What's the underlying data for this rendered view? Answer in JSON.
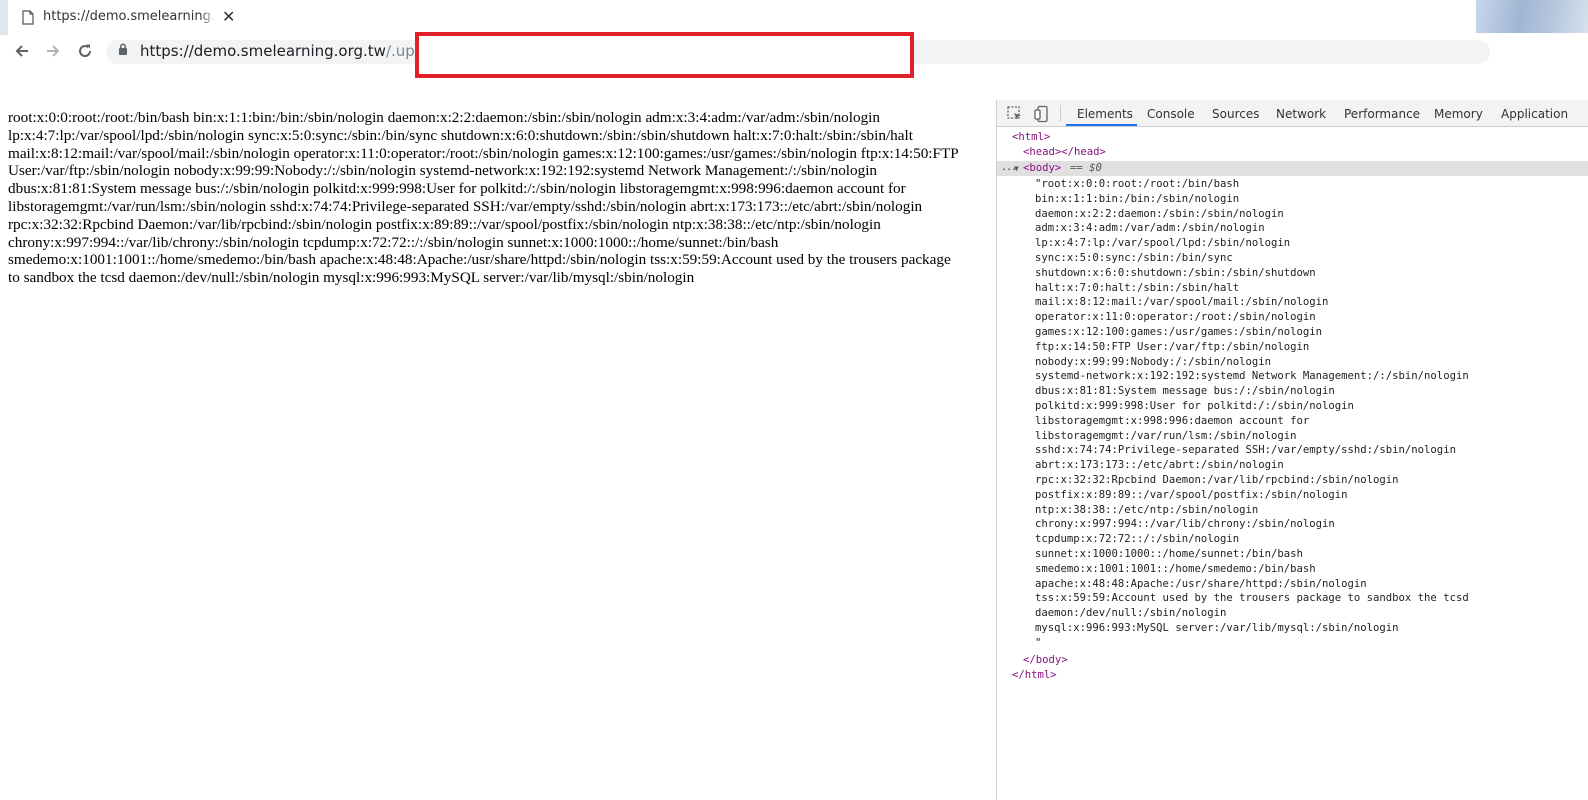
{
  "browser": {
    "tab_title": "https://demo.smelearning.org.tw/.upload/",
    "tab_close": "✕",
    "url_host": "https://demo.smelearning.org.tw",
    "url_path": "/.upload/",
    "icons": {
      "back": "arrow-left-icon",
      "forward": "arrow-right-icon",
      "reload": "reload-icon",
      "lock": "lock-icon",
      "favicon": "page-icon"
    },
    "redaction_color": "#e2202a"
  },
  "page": {
    "content": "root:x:0:0:root:/root:/bin/bash bin:x:1:1:bin:/bin:/sbin/nologin daemon:x:2:2:daemon:/sbin:/sbin/nologin adm:x:3:4:adm:/var/adm:/sbin/nologin lp:x:4:7:lp:/var/spool/lpd:/sbin/nologin sync:x:5:0:sync:/sbin:/bin/sync shutdown:x:6:0:shutdown:/sbin:/sbin/shutdown halt:x:7:0:halt:/sbin:/sbin/halt mail:x:8:12:mail:/var/spool/mail:/sbin/nologin operator:x:11:0:operator:/root:/sbin/nologin games:x:12:100:games:/usr/games:/sbin/nologin ftp:x:14:50:FTP User:/var/ftp:/sbin/nologin nobody:x:99:99:Nobody:/:/sbin/nologin systemd-network:x:192:192:systemd Network Management:/:/sbin/nologin dbus:x:81:81:System message bus:/:/sbin/nologin polkitd:x:999:998:User for polkitd:/:/sbin/nologin libstoragemgmt:x:998:996:daemon account for libstoragemgmt:/var/run/lsm:/sbin/nologin sshd:x:74:74:Privilege-separated SSH:/var/empty/sshd:/sbin/nologin abrt:x:173:173::/etc/abrt:/sbin/nologin rpc:x:32:32:Rpcbind Daemon:/var/lib/rpcbind:/sbin/nologin postfix:x:89:89::/var/spool/postfix:/sbin/nologin ntp:x:38:38::/etc/ntp:/sbin/nologin chrony:x:997:994::/var/lib/chrony:/sbin/nologin tcpdump:x:72:72::/:/sbin/nologin sunnet:x:1000:1000::/home/sunnet:/bin/bash smedemo:x:1001:1001::/home/smedemo:/bin/bash apache:x:48:48:Apache:/usr/share/httpd:/sbin/nologin tss:x:59:59:Account used by the trousers package to sandbox the tcsd daemon:/dev/null:/sbin/nologin mysql:x:996:993:MySQL server:/var/lib/mysql:/sbin/nologin"
  },
  "devtools": {
    "icons": {
      "inspect": "inspect-element-icon",
      "device": "device-toolbar-icon"
    },
    "tabs": [
      "Elements",
      "Console",
      "Sources",
      "Network",
      "Performance",
      "Memory",
      "Application"
    ],
    "active_tab": "Elements",
    "dom": {
      "html_open": "<html>",
      "head": "<head></head>",
      "body_open": "<body>",
      "body_ref": "== $0",
      "ellipsis": "...",
      "text_lines": [
        "\"root:x:0:0:root:/root:/bin/bash",
        "bin:x:1:1:bin:/bin:/sbin/nologin",
        "daemon:x:2:2:daemon:/sbin:/sbin/nologin",
        "adm:x:3:4:adm:/var/adm:/sbin/nologin",
        "lp:x:4:7:lp:/var/spool/lpd:/sbin/nologin",
        "sync:x:5:0:sync:/sbin:/bin/sync",
        "shutdown:x:6:0:shutdown:/sbin:/sbin/shutdown",
        "halt:x:7:0:halt:/sbin:/sbin/halt",
        "mail:x:8:12:mail:/var/spool/mail:/sbin/nologin",
        "operator:x:11:0:operator:/root:/sbin/nologin",
        "games:x:12:100:games:/usr/games:/sbin/nologin",
        "ftp:x:14:50:FTP User:/var/ftp:/sbin/nologin",
        "nobody:x:99:99:Nobody:/:/sbin/nologin",
        "systemd-network:x:192:192:systemd Network Management:/:/sbin/nologin",
        "dbus:x:81:81:System message bus:/:/sbin/nologin",
        "polkitd:x:999:998:User for polkitd:/:/sbin/nologin",
        "libstoragemgmt:x:998:996:daemon account for",
        "libstoragemgmt:/var/run/lsm:/sbin/nologin",
        "sshd:x:74:74:Privilege-separated SSH:/var/empty/sshd:/sbin/nologin",
        "abrt:x:173:173::/etc/abrt:/sbin/nologin",
        "rpc:x:32:32:Rpcbind Daemon:/var/lib/rpcbind:/sbin/nologin",
        "postfix:x:89:89::/var/spool/postfix:/sbin/nologin",
        "ntp:x:38:38::/etc/ntp:/sbin/nologin",
        "chrony:x:997:994::/var/lib/chrony:/sbin/nologin",
        "tcpdump:x:72:72::/:/sbin/nologin",
        "sunnet:x:1000:1000::/home/sunnet:/bin/bash",
        "smedemo:x:1001:1001::/home/smedemo:/bin/bash",
        "apache:x:48:48:Apache:/usr/share/httpd:/sbin/nologin",
        "tss:x:59:59:Account used by the trousers package to sandbox the tcsd",
        "daemon:/dev/null:/sbin/nologin",
        "mysql:x:996:993:MySQL server:/var/lib/mysql:/sbin/nologin",
        "\""
      ],
      "body_close": "</body>",
      "html_close": "</html>"
    }
  }
}
